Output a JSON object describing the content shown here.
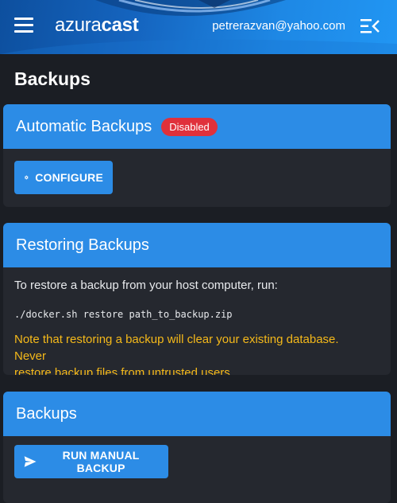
{
  "header": {
    "logo_part1": "azura",
    "logo_part2": "cast",
    "user_email": "petrerazvan@yahoo.com"
  },
  "page": {
    "title": "Backups"
  },
  "automatic_backups": {
    "title": "Automatic Backups",
    "status_badge": "Disabled",
    "configure_button": "CONFIGURE"
  },
  "restoring_backups": {
    "title": "Restoring Backups",
    "instructions": "To restore a backup from your host computer, run:",
    "command": "./docker.sh restore path_to_backup.zip",
    "warning_line1": "Note that restoring a backup will clear your existing database. Never",
    "warning_line2": "restore backup files from untrusted users."
  },
  "backups": {
    "title": "Backups",
    "run_manual_button": "RUN MANUAL BACKUP"
  },
  "colors": {
    "accent": "#2c8ce6",
    "page_background": "#1b1e24",
    "card_background": "#25282f",
    "badge_danger": "#e0313b",
    "warning_text": "#f5b91a"
  },
  "icons": [
    "menu-icon",
    "sidebar-toggle-icon",
    "gear-icon",
    "send-icon"
  ]
}
